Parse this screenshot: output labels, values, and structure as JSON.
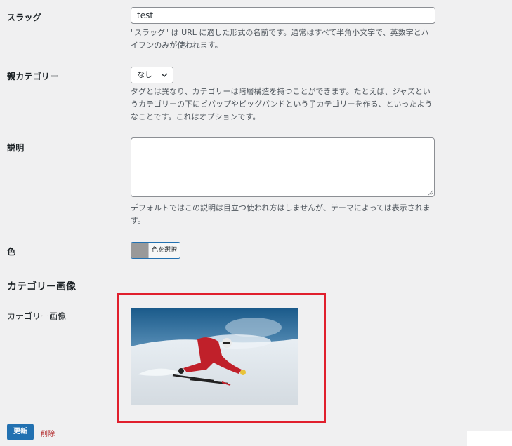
{
  "slug": {
    "label": "スラッグ",
    "value": "test",
    "description": "\"スラッグ\" は URL に適した形式の名前です。通常はすべて半角小文字で、英数字とハイフンのみが使われます。"
  },
  "parent": {
    "label": "親カテゴリー",
    "selected": "なし",
    "description": "タグとは異なり、カテゴリーは階層構造を持つことができます。たとえば、ジャズというカテゴリーの下にビバップやビッグバンドという子カテゴリーを作る、といったようなことです。これはオプションです。"
  },
  "description_field": {
    "label": "説明",
    "value": "",
    "description": "デフォルトではこの説明は目立つ使われ方はしませんが、テーマによっては表示されます。"
  },
  "color": {
    "label": "色",
    "button_label": "色を選択",
    "swatch_color": "#999999"
  },
  "category_image": {
    "section_heading": "カテゴリー画像",
    "label": "カテゴリー画像",
    "highlight_color": "#e01f2d"
  },
  "actions": {
    "update_label": "更新",
    "delete_label": "削除"
  },
  "colors": {
    "primary": "#2271b1",
    "danger": "#b32d2e",
    "background": "#f0f0f1"
  }
}
